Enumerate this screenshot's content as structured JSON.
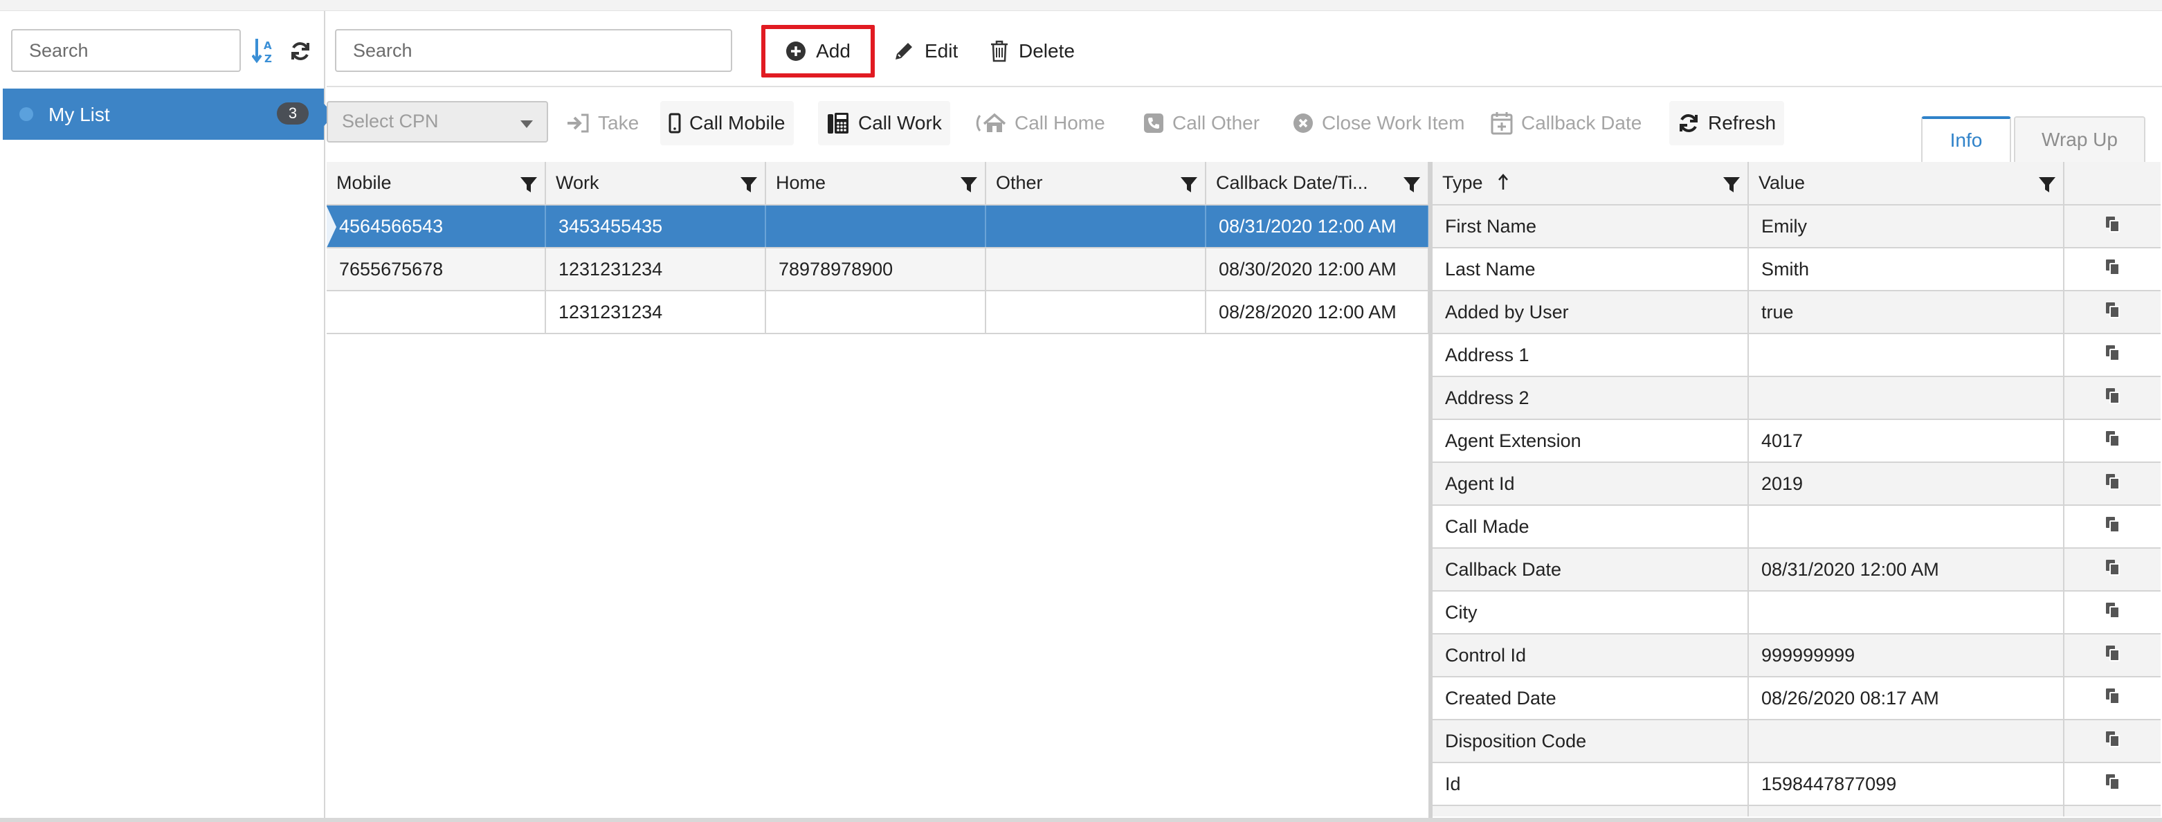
{
  "left_panel": {
    "search_placeholder": "Search",
    "list": {
      "label": "My List",
      "count": "3"
    }
  },
  "toolbar": {
    "search_placeholder": "Search",
    "add_label": "Add",
    "edit_label": "Edit",
    "delete_label": "Delete"
  },
  "actions": {
    "cpn_placeholder": "Select CPN",
    "take": "Take",
    "call_mobile": "Call Mobile",
    "call_work": "Call Work",
    "call_home": "Call Home",
    "call_other": "Call Other",
    "close_work_item": "Close Work Item",
    "callback_date": "Callback Date",
    "refresh": "Refresh"
  },
  "tabs": {
    "info": "Info",
    "wrap_up": "Wrap Up"
  },
  "contacts": {
    "columns": [
      "Mobile",
      "Work",
      "Home",
      "Other",
      "Callback Date/Ti..."
    ],
    "rows": [
      [
        "4564566543",
        "3453455435",
        "",
        "",
        "08/31/2020 12:00 AM"
      ],
      [
        "7655675678",
        "1231231234",
        "78978978900",
        "",
        "08/30/2020 12:00 AM"
      ],
      [
        "",
        "1231231234",
        "",
        "",
        "08/28/2020 12:00 AM"
      ]
    ]
  },
  "info": {
    "columns": [
      "Type",
      "Value"
    ],
    "rows": [
      [
        "First Name",
        "Emily"
      ],
      [
        "Last Name",
        "Smith"
      ],
      [
        "Added by User",
        "true"
      ],
      [
        "Address 1",
        ""
      ],
      [
        "Address 2",
        ""
      ],
      [
        "Agent Extension",
        "4017"
      ],
      [
        "Agent Id",
        "2019"
      ],
      [
        "Call Made",
        ""
      ],
      [
        "Callback Date",
        "08/31/2020 12:00 AM"
      ],
      [
        "City",
        ""
      ],
      [
        "Control Id",
        "999999999"
      ],
      [
        "Created Date",
        "08/26/2020 08:17 AM"
      ],
      [
        "Disposition Code",
        ""
      ],
      [
        "Id",
        "1598447877099"
      ]
    ]
  },
  "colors": {
    "accent": "#3d84c6",
    "highlight": "#e11b22",
    "tab_active": "#2f82c9"
  }
}
